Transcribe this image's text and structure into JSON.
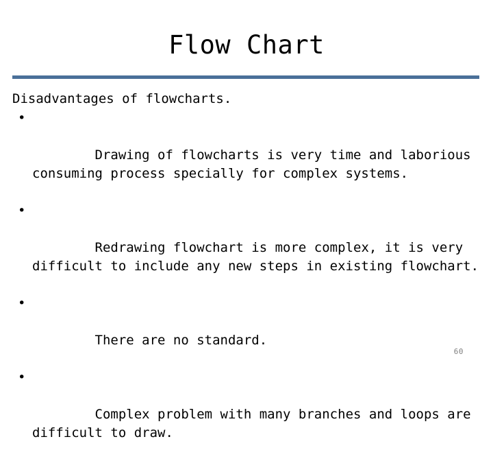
{
  "slide": {
    "title": "Flow Chart",
    "accent_color": "#4a7099",
    "background_color": "#ffffff",
    "text_color": "#000000",
    "page_number": "60",
    "page_number_color": "#808080"
  },
  "content": {
    "lead_line": "Disadvantages of flowcharts.",
    "bullet_marker": "•",
    "bullets": [
      "Drawing of flowcharts is very time and laborious consuming process specially for complex systems.",
      "Redrawing flowchart is more complex, it is very difficult to include any new steps in existing flowchart.",
      "There are no standard.",
      "Complex problem with many branches and loops are difficult to draw."
    ]
  }
}
